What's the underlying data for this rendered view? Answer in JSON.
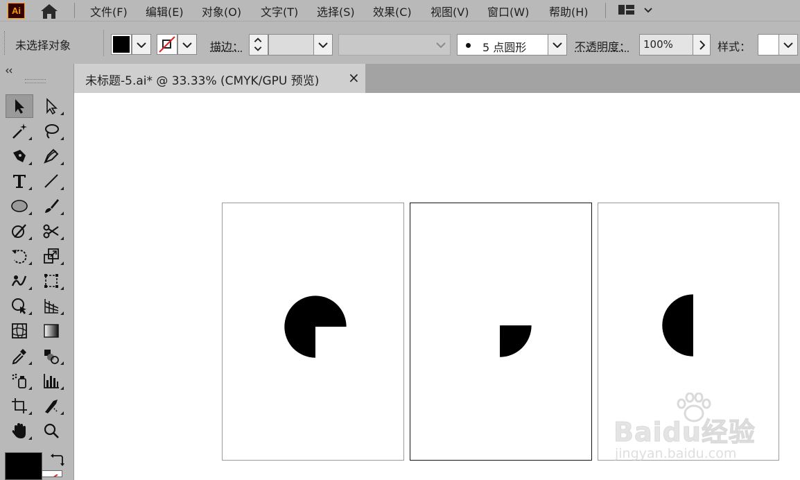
{
  "menubar": {
    "app_logo": "Ai",
    "items": [
      "文件(F)",
      "编辑(E)",
      "对象(O)",
      "文字(T)",
      "选择(S)",
      "效果(C)",
      "视图(V)",
      "窗口(W)",
      "帮助(H)"
    ]
  },
  "controlbar": {
    "selection_status": "未选择对象",
    "stroke_label": "描边：",
    "brush_value": "5 点圆形",
    "opacity_label": "不透明度：",
    "opacity_value": "100%",
    "style_label": "样式："
  },
  "document_tab": {
    "title": "未标题-5.ai* @ 33.33% (CMYK/GPU 预览)",
    "close_glyph": "×"
  },
  "colors": {
    "ui_gray": "#b9b9b9",
    "tab_inactive": "#a3a3a3",
    "tab_active": "#cfcfcf",
    "canvas": "#ffffff",
    "shape_fill": "#000000",
    "no_stroke_slash": "#e02020",
    "logo_bg": "#330000",
    "logo_fg": "#ff9a00"
  },
  "watermark": {
    "brand": "Baidu经验",
    "url": "jingyan.baidu.com"
  }
}
